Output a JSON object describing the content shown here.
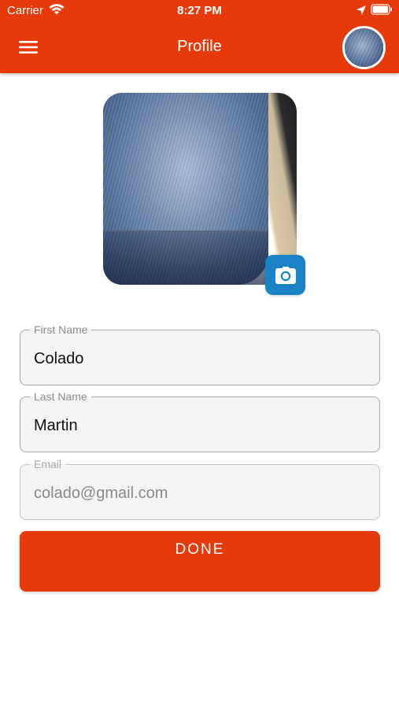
{
  "status_bar": {
    "carrier": "Carrier",
    "time": "8:27 PM"
  },
  "nav": {
    "title": "Profile"
  },
  "form": {
    "first_name": {
      "label": "First Name",
      "value": "Colado"
    },
    "last_name": {
      "label": "Last Name",
      "value": "Martin"
    },
    "email": {
      "label": "Email",
      "value": "colado@gmail.com"
    }
  },
  "actions": {
    "done_label": "DONE"
  },
  "icons": {
    "menu": "hamburger-menu-icon",
    "camera": "camera-icon",
    "wifi": "wifi-icon",
    "location": "location-arrow-icon",
    "battery": "battery-icon"
  },
  "colors": {
    "brand": "#e63a0b",
    "camera_button": "#1a83c6",
    "field_bg": "#f4f4f4"
  }
}
